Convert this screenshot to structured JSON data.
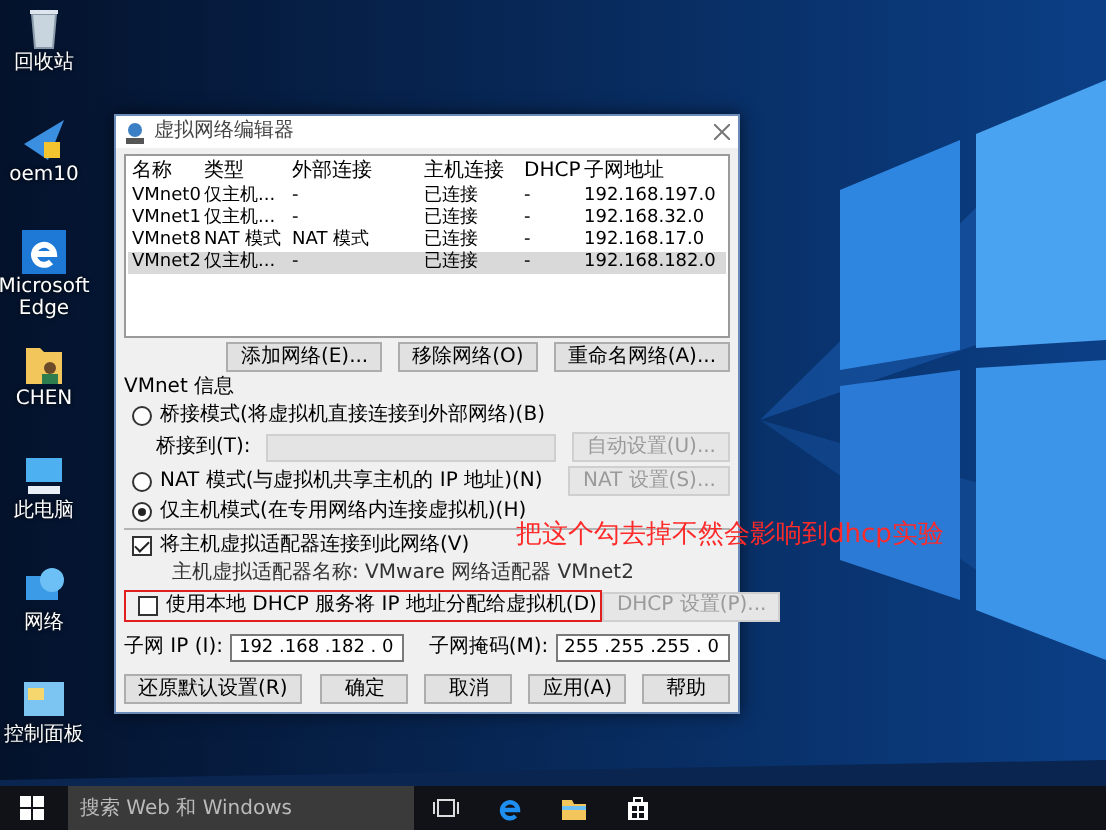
{
  "desktop_icons": [
    {
      "label": "回收站",
      "kind": "recycle"
    },
    {
      "label": "oem10",
      "kind": "shortcut"
    },
    {
      "label": "Microsoft Edge",
      "kind": "browser"
    },
    {
      "label": "CHEN",
      "kind": "userfolder"
    },
    {
      "label": "此电脑",
      "kind": "computer"
    },
    {
      "label": "网络",
      "kind": "network"
    },
    {
      "label": "控制面板",
      "kind": "panel"
    }
  ],
  "dialog": {
    "title": "虚拟网络编辑器",
    "table": {
      "columns": [
        "名称",
        "类型",
        "外部连接",
        "主机连接",
        "DHCP",
        "子网地址"
      ],
      "rows": [
        {
          "cells": [
            "VMnet0",
            "仅主机...",
            "-",
            "已连接",
            "-",
            "192.168.197.0"
          ],
          "selected": false
        },
        {
          "cells": [
            "VMnet1",
            "仅主机...",
            "-",
            "已连接",
            "-",
            "192.168.32.0"
          ],
          "selected": false
        },
        {
          "cells": [
            "VMnet8",
            "NAT 模式",
            "NAT 模式",
            "已连接",
            "-",
            "192.168.17.0"
          ],
          "selected": false
        },
        {
          "cells": [
            "VMnet2",
            "仅主机...",
            "-",
            "已连接",
            "-",
            "192.168.182.0"
          ],
          "selected": true
        }
      ]
    },
    "network_buttons": [
      "添加网络(E)...",
      "移除网络(O)",
      "重命名网络(A)..."
    ],
    "info_label": "VMnet 信息",
    "modes": [
      {
        "label": "桥接模式(将虚拟机直接连接到外部网络)(B)",
        "selected": false
      },
      {
        "label": "NAT 模式(与虚拟机共享主机的 IP 地址)(N)",
        "selected": false
      },
      {
        "label": "仅主机模式(在专用网络内连接虚拟机)(H)",
        "selected": true
      }
    ],
    "bridge_label": "桥接到(T):",
    "bridge_select": {
      "disabled": true
    },
    "auto_button": {
      "label": "自动设置(U)...",
      "disabled": true
    },
    "nat_button": {
      "label": "NAT 设置(S)...",
      "disabled": true
    },
    "adapter_check": {
      "label": "将主机虚拟适配器连接到此网络(V)",
      "checked": true
    },
    "adapter_name": "主机虚拟适配器名称: VMware 网络适配器 VMnet2",
    "dhcp_check": {
      "label": "使用本地 DHCP 服务将 IP 地址分配给虚拟机(D)",
      "checked": false
    },
    "dhcp_button": {
      "label": "DHCP 设置(P)...",
      "disabled": true
    },
    "subnet_ip_label": "子网 IP (I):",
    "subnet_ip": "192 .168 .182 . 0",
    "subnet_mask_label": "子网掩码(M):",
    "subnet_mask": "255 .255 .255 . 0",
    "restore_button": "还原默认设置(R)",
    "footer_buttons": [
      "确定",
      "取消",
      "应用(A)",
      "帮助"
    ]
  },
  "annotation": "把这个勾去掉不然会影响到dhcp实验",
  "taskbar": {
    "search_placeholder": "搜索 Web 和 Windows"
  }
}
